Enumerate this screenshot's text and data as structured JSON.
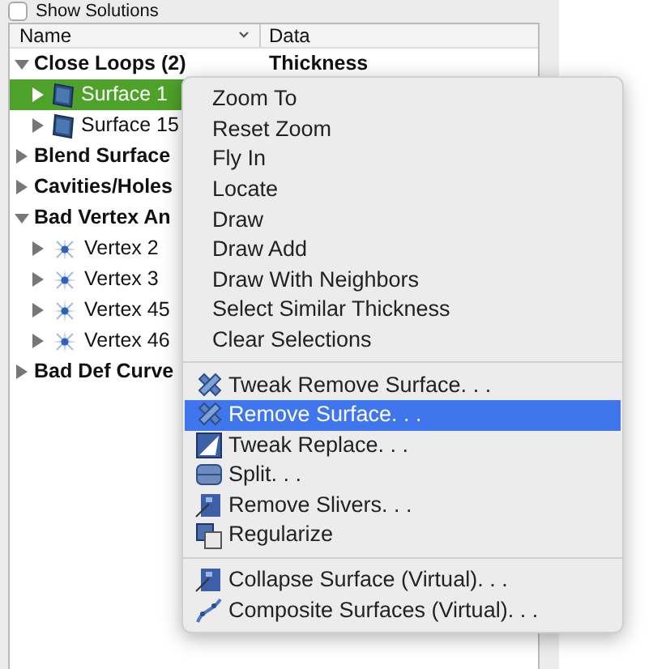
{
  "show_solutions": {
    "label": "Show Solutions",
    "checked": false
  },
  "tree": {
    "columns": [
      "Name",
      "Data"
    ],
    "items": [
      {
        "label": "Close Loops (2)",
        "kind": "group",
        "expanded": true,
        "selected": false,
        "data": "Thickness",
        "children": [
          {
            "label": "Surface 1",
            "kind": "surface",
            "expanded": false,
            "selected": true
          },
          {
            "label": "Surface 15",
            "kind": "surface",
            "expanded": false,
            "selected": false
          }
        ]
      },
      {
        "label": "Blend Surface",
        "kind": "group",
        "expanded": false,
        "selected": false
      },
      {
        "label": "Cavities/Holes",
        "kind": "group",
        "expanded": false,
        "selected": false
      },
      {
        "label": "Bad Vertex An",
        "kind": "group",
        "expanded": true,
        "selected": false,
        "children": [
          {
            "label": "Vertex 2",
            "kind": "vertex",
            "expanded": false,
            "selected": false
          },
          {
            "label": "Vertex 3",
            "kind": "vertex",
            "expanded": false,
            "selected": false
          },
          {
            "label": "Vertex 45",
            "kind": "vertex",
            "expanded": false,
            "selected": false
          },
          {
            "label": "Vertex 46",
            "kind": "vertex",
            "expanded": false,
            "selected": false
          }
        ]
      },
      {
        "label": "Bad Def Curve",
        "kind": "group",
        "expanded": false,
        "selected": false
      }
    ]
  },
  "context_menu": {
    "sections": [
      [
        {
          "label": "Zoom To",
          "kind": "plain",
          "selected": false
        },
        {
          "label": "Reset Zoom",
          "kind": "plain",
          "selected": false
        },
        {
          "label": "Fly In",
          "kind": "plain",
          "selected": false
        },
        {
          "label": "Locate",
          "kind": "plain",
          "selected": false
        },
        {
          "label": "Draw",
          "kind": "plain",
          "selected": false
        },
        {
          "label": "Draw Add",
          "kind": "plain",
          "selected": false
        },
        {
          "label": "Draw With Neighbors",
          "kind": "plain",
          "selected": false
        },
        {
          "label": "Select Similar Thickness",
          "kind": "plain",
          "selected": false
        },
        {
          "label": "Clear Selections",
          "kind": "plain",
          "selected": false
        }
      ],
      [
        {
          "label": "Tweak Remove Surface. . .",
          "kind": "icon",
          "selected": false
        },
        {
          "label": "Remove Surface. . .",
          "kind": "icon",
          "selected": true
        },
        {
          "label": "Tweak Replace. . .",
          "kind": "icon",
          "selected": false
        },
        {
          "label": "Split. . .",
          "kind": "icon",
          "selected": false
        },
        {
          "label": "Remove Slivers. . .",
          "kind": "icon",
          "selected": false
        },
        {
          "label": "Regularize",
          "kind": "icon",
          "selected": false
        }
      ],
      [
        {
          "label": "Collapse Surface (Virtual). . .",
          "kind": "icon",
          "selected": false
        },
        {
          "label": "Composite Surfaces (Virtual). . .",
          "kind": "icon",
          "selected": false
        }
      ]
    ]
  }
}
